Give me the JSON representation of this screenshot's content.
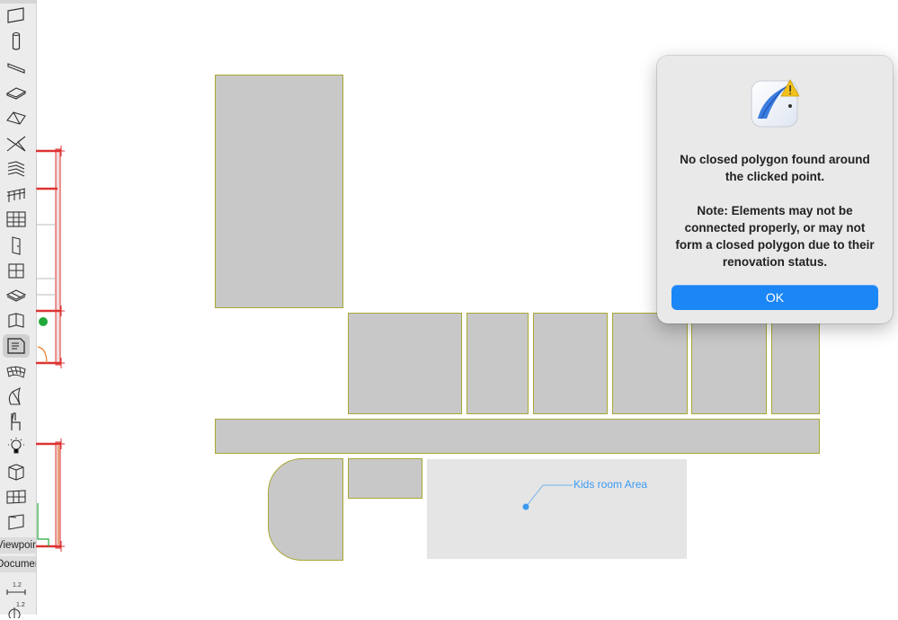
{
  "toolbox": {
    "items": [
      {
        "name": "wall-tool-icon"
      },
      {
        "name": "column-tool-icon"
      },
      {
        "name": "beam-tool-icon"
      },
      {
        "name": "slab-tool-icon"
      },
      {
        "name": "roof-tool-icon"
      },
      {
        "name": "shell-tool-icon"
      },
      {
        "name": "stair-tool-icon"
      },
      {
        "name": "railing-tool-icon"
      },
      {
        "name": "curtain-wall-tool-icon"
      },
      {
        "name": "door-tool-icon"
      },
      {
        "name": "window-tool-icon"
      },
      {
        "name": "skylight-tool-icon"
      },
      {
        "name": "opening-tool-icon"
      },
      {
        "name": "zone-tool-icon",
        "selected": true
      },
      {
        "name": "mesh-tool-icon"
      },
      {
        "name": "morph-tool-icon"
      },
      {
        "name": "object-tool-icon"
      },
      {
        "name": "lamp-tool-icon"
      },
      {
        "name": "equipment-tool-icon"
      },
      {
        "name": "grid-tool-icon"
      },
      {
        "name": "section-tool-icon"
      }
    ],
    "viewpoint_label": "Viewpoint",
    "document_label": "Document",
    "dimension_value": "1.2",
    "angle_value": "1.2"
  },
  "canvas": {
    "zone_label": "Kids room Area",
    "colors": {
      "zone_fill": "#c8c8c8",
      "zone_border": "#a8a834",
      "label": "#3b9af2",
      "highlight": "#e5e5e5"
    }
  },
  "dialog": {
    "message": "No closed polygon found around the clicked point.",
    "note": "Note: Elements may not be connected properly, or may not form a closed polygon due to their renovation status.",
    "ok_label": "OK",
    "accent_color": "#1b86f5",
    "icon": "app-warning-icon"
  }
}
